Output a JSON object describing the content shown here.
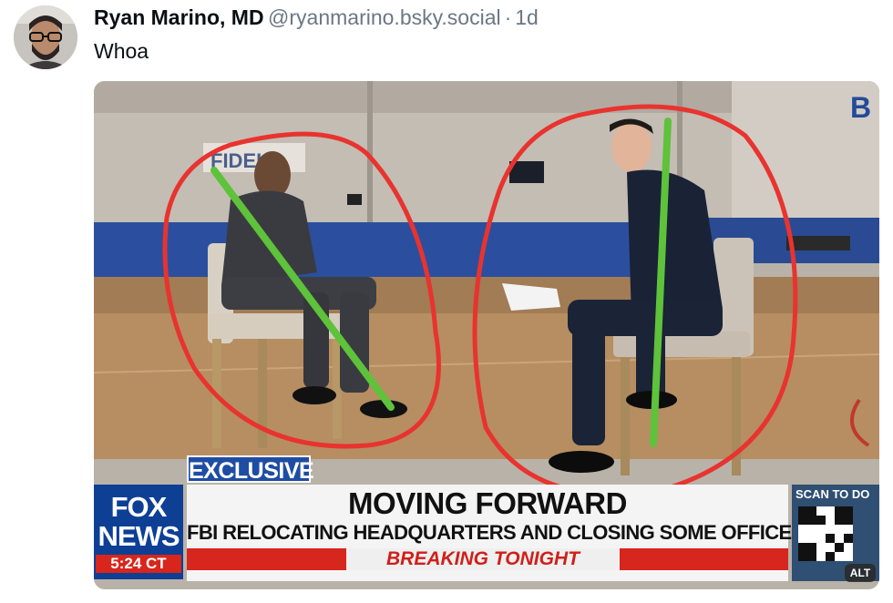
{
  "post": {
    "author_name": "Ryan Marino, MD",
    "handle": "@ryanmarino.bsky.social",
    "separator": "·",
    "age": "1d",
    "text": "Whoa"
  },
  "image": {
    "chyron": {
      "exclusive": "EXCLUSIVE",
      "network_line1": "FOX",
      "network_line2": "NEWS",
      "time": "5:24 CT",
      "headline": "MOVING FORWARD",
      "subheadline": "FBI RELOCATING HEADQUARTERS AND CLOSING SOME OFFICES",
      "breaking": "BREAKING TONIGHT",
      "qr_caption": "SCAN TO DO"
    },
    "alt_badge": "ALT"
  },
  "colors": {
    "annotation_red": "#e8332f",
    "annotation_green": "#5ec23b",
    "fox_blue": "#0d3f95",
    "chyron_red": "#d7261d"
  }
}
